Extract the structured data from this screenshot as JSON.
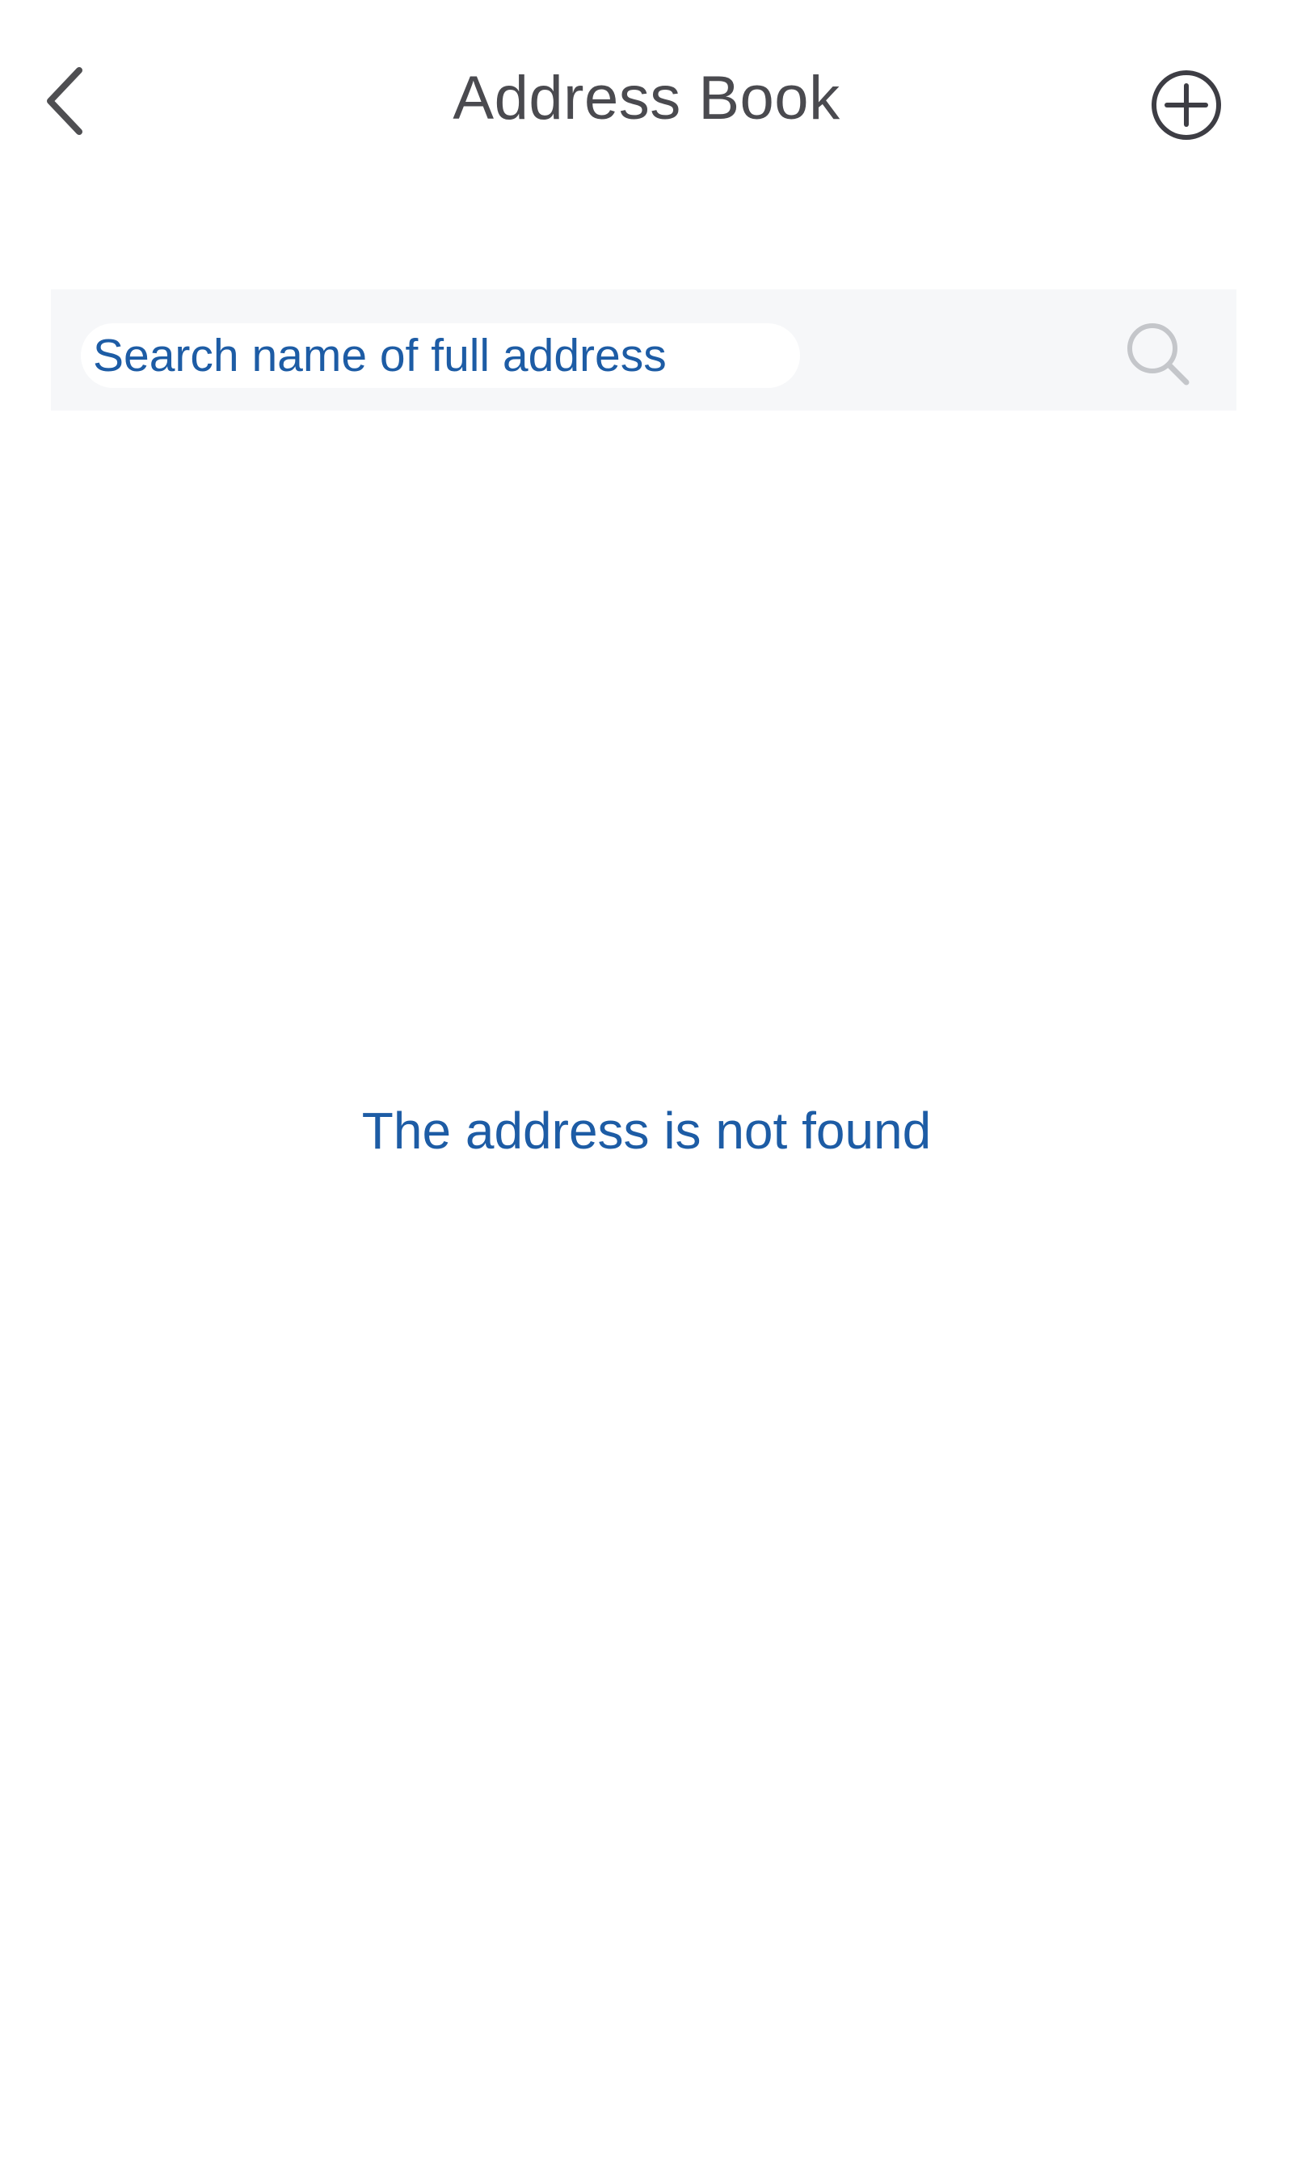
{
  "header": {
    "title": "Address Book",
    "back_icon": "chevron-left-icon",
    "add_icon": "plus-circle-icon"
  },
  "search": {
    "placeholder": "Search name of full address",
    "value": "",
    "icon": "search-icon"
  },
  "empty_state": {
    "message": "The address is not found"
  },
  "colors": {
    "accent": "#1d5ca5",
    "title": "#4a4a4f",
    "search_bg": "#f6f7f9",
    "icon_muted": "#c4c6ca"
  }
}
